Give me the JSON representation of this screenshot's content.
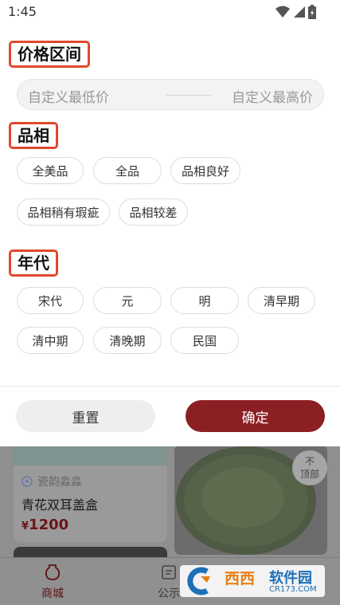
{
  "status_bar": {
    "time": "1:45"
  },
  "price_section": {
    "title": "价格区间",
    "min_placeholder": "自定义最低价",
    "max_placeholder": "自定义最高价"
  },
  "condition_section": {
    "title": "品相",
    "options": [
      "全美品",
      "全品",
      "品相良好",
      "品相稍有瑕疵",
      "品相较差"
    ]
  },
  "era_section": {
    "title": "年代",
    "options": [
      "宋代",
      "元",
      "明",
      "清早期",
      "清中期",
      "清晚期",
      "民国"
    ]
  },
  "actions": {
    "reset": "重置",
    "confirm": "确定"
  },
  "background": {
    "shop_name": "瓷韵淼淼",
    "item_title": "青花双耳盖盒",
    "item_price_symbol": "¥",
    "item_price": "1200",
    "top_button_line1": "不",
    "top_button_line2": "顶部",
    "tabs": [
      "商城",
      "公示"
    ],
    "watermark_text1": "西西",
    "watermark_text2": "软件园",
    "watermark_url": "CR173.COM"
  },
  "colors": {
    "accent": "#8c1f23",
    "highlight_box": "#e0492f"
  }
}
